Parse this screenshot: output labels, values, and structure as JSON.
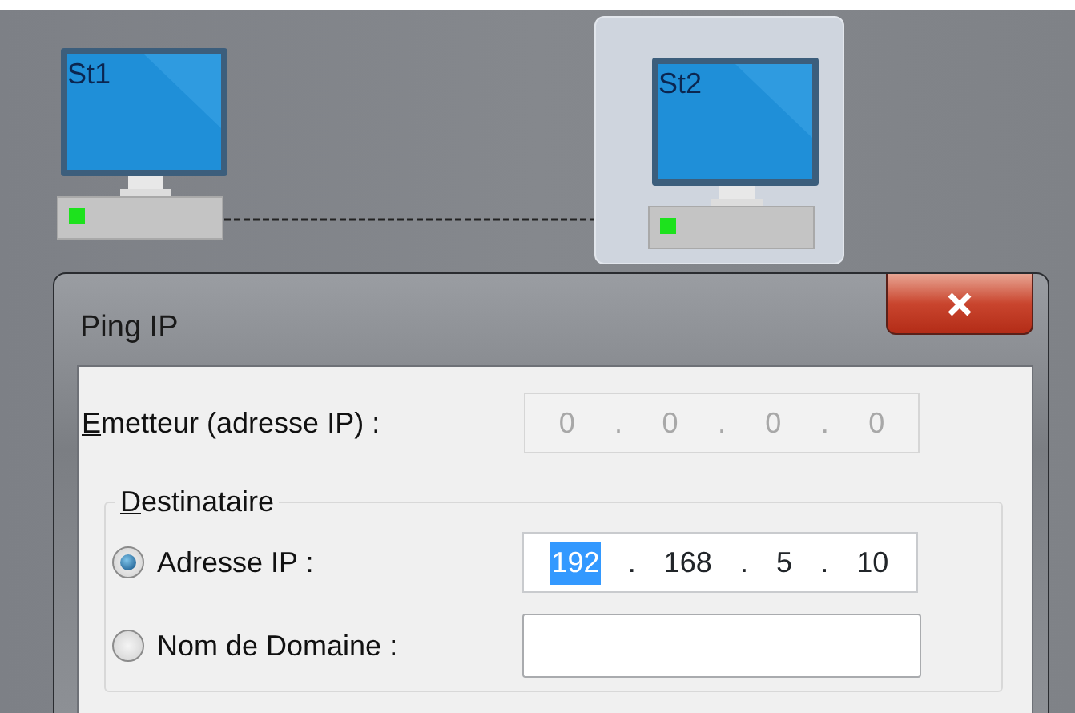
{
  "network": {
    "nodes": [
      {
        "label": "St1",
        "selected": false
      },
      {
        "label": "St2",
        "selected": true
      }
    ],
    "links": [
      {
        "kind": "dashed"
      }
    ]
  },
  "dialog": {
    "title": "Ping IP",
    "sender": {
      "separator": ".",
      "label": "Emetteur (adresse IP) :",
      "access_key_underlined": true,
      "disabled": true,
      "octets": [
        {
          "text": "0",
          "selected": false
        },
        {
          "text": "0",
          "selected": false
        },
        {
          "text": "0",
          "selected": false
        },
        {
          "text": "0",
          "selected": false
        }
      ]
    },
    "destination": {
      "title": "Destinataire",
      "access_key_underlined": true,
      "options": [
        {
          "kind": "ip",
          "label": "Adresse IP :",
          "selected": true,
          "separator": ".",
          "octets": [
            {
              "text": "192",
              "selected": true
            },
            {
              "text": "168",
              "selected": false
            },
            {
              "text": "5",
              "selected": false
            },
            {
              "text": "10",
              "selected": false
            }
          ]
        },
        {
          "kind": "domain",
          "label": "Nom de Domaine :",
          "selected": false
        }
      ]
    }
  }
}
